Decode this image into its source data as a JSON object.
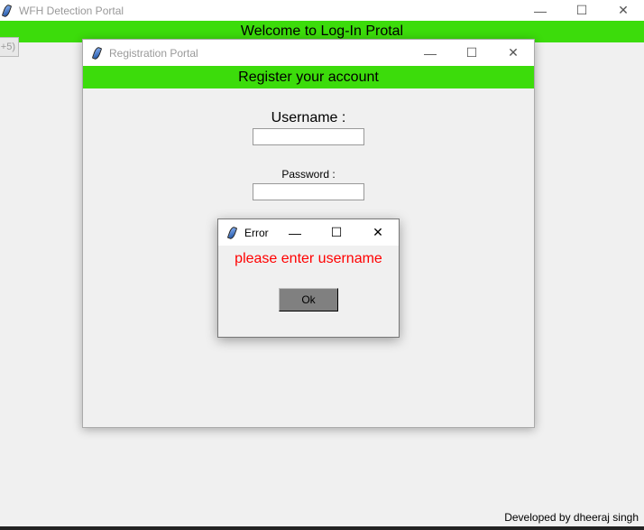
{
  "main_window": {
    "title": "WFH Detection Portal",
    "banner": "Welcome to Log-In Protal",
    "partial_button": "+5)",
    "footer": "Developed by dheeraj singh"
  },
  "registration": {
    "title": "Registration Portal",
    "banner": "Register your account",
    "username_label": "Username :",
    "username_value": "",
    "password_label": "Password :",
    "password_value": ""
  },
  "error_dialog": {
    "title": "Error",
    "message": "please enter username",
    "ok_label": "Ok"
  },
  "colors": {
    "banner": "#3cdc0b",
    "error_text": "#ff0000"
  }
}
